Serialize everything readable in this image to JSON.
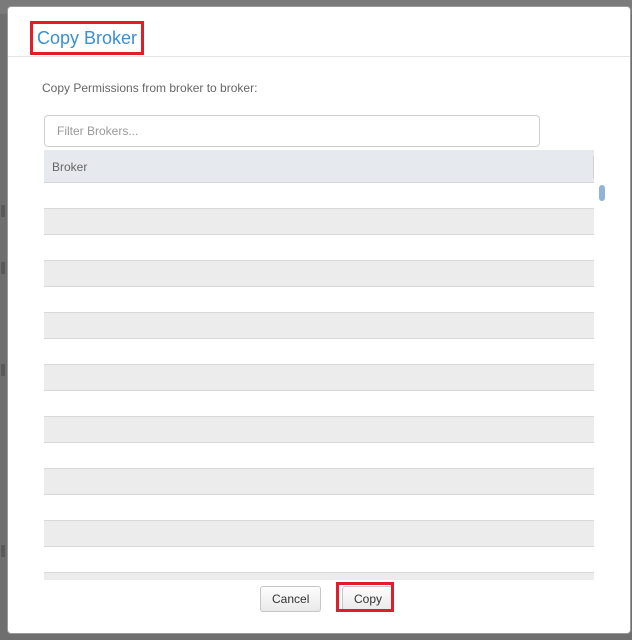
{
  "dialog": {
    "title": "Copy Broker",
    "instruction": "Copy Permissions from broker to broker:"
  },
  "filter": {
    "placeholder": "Filter Brokers...",
    "value": ""
  },
  "grid": {
    "columns": [
      "Broker"
    ],
    "rows": [
      "",
      "",
      "",
      "",
      "",
      "",
      "",
      "",
      "",
      "",
      "",
      "",
      "",
      "",
      "",
      ""
    ]
  },
  "footer": {
    "cancel_label": "Cancel",
    "copy_label": "Copy"
  },
  "colors": {
    "title": "#3a8fd3",
    "highlight": "#e11d2b",
    "grid_header": "#e6e9ee",
    "alt_row": "#ececec",
    "scroll_thumb": "#8fb3d9"
  },
  "icons": {
    "scrollbar": "scrollbar-thumb"
  }
}
